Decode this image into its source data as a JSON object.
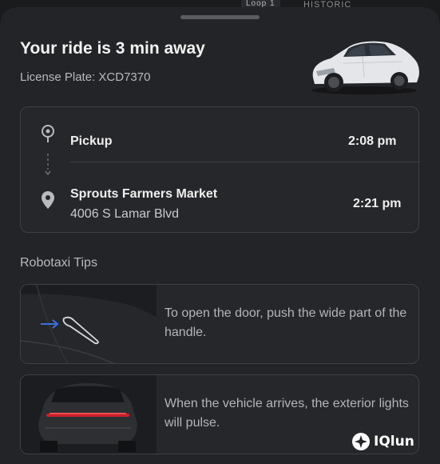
{
  "map": {
    "road_label": "Loop 1",
    "district_label": "HISTORIC"
  },
  "ride": {
    "status_title": "Your ride is 3 min away",
    "license_plate": "License Plate: XCD7370"
  },
  "route": {
    "pickup": {
      "label": "Pickup",
      "time": "2:08 pm",
      "icon": "pickup-pin-icon"
    },
    "destination": {
      "name": "Sprouts Farmers Market",
      "address": "4006 S Lamar Blvd",
      "time": "2:21 pm",
      "icon": "map-pin-icon"
    }
  },
  "tips": {
    "section_title": "Robotaxi Tips",
    "items": [
      {
        "text": "To open the door, push the wide part of the handle.",
        "icon": "door-handle-illustration"
      },
      {
        "text": "When the vehicle arrives, the exterior lights will pulse.",
        "icon": "rear-lights-illustration"
      }
    ]
  },
  "watermark": {
    "text": "IQlun"
  },
  "colors": {
    "sheet_bg": "#232427",
    "card_bg": "#26272a",
    "card_border": "#3f4044",
    "arrow_blue": "#3b6fe0",
    "tail_light_red": "#c8202a"
  }
}
